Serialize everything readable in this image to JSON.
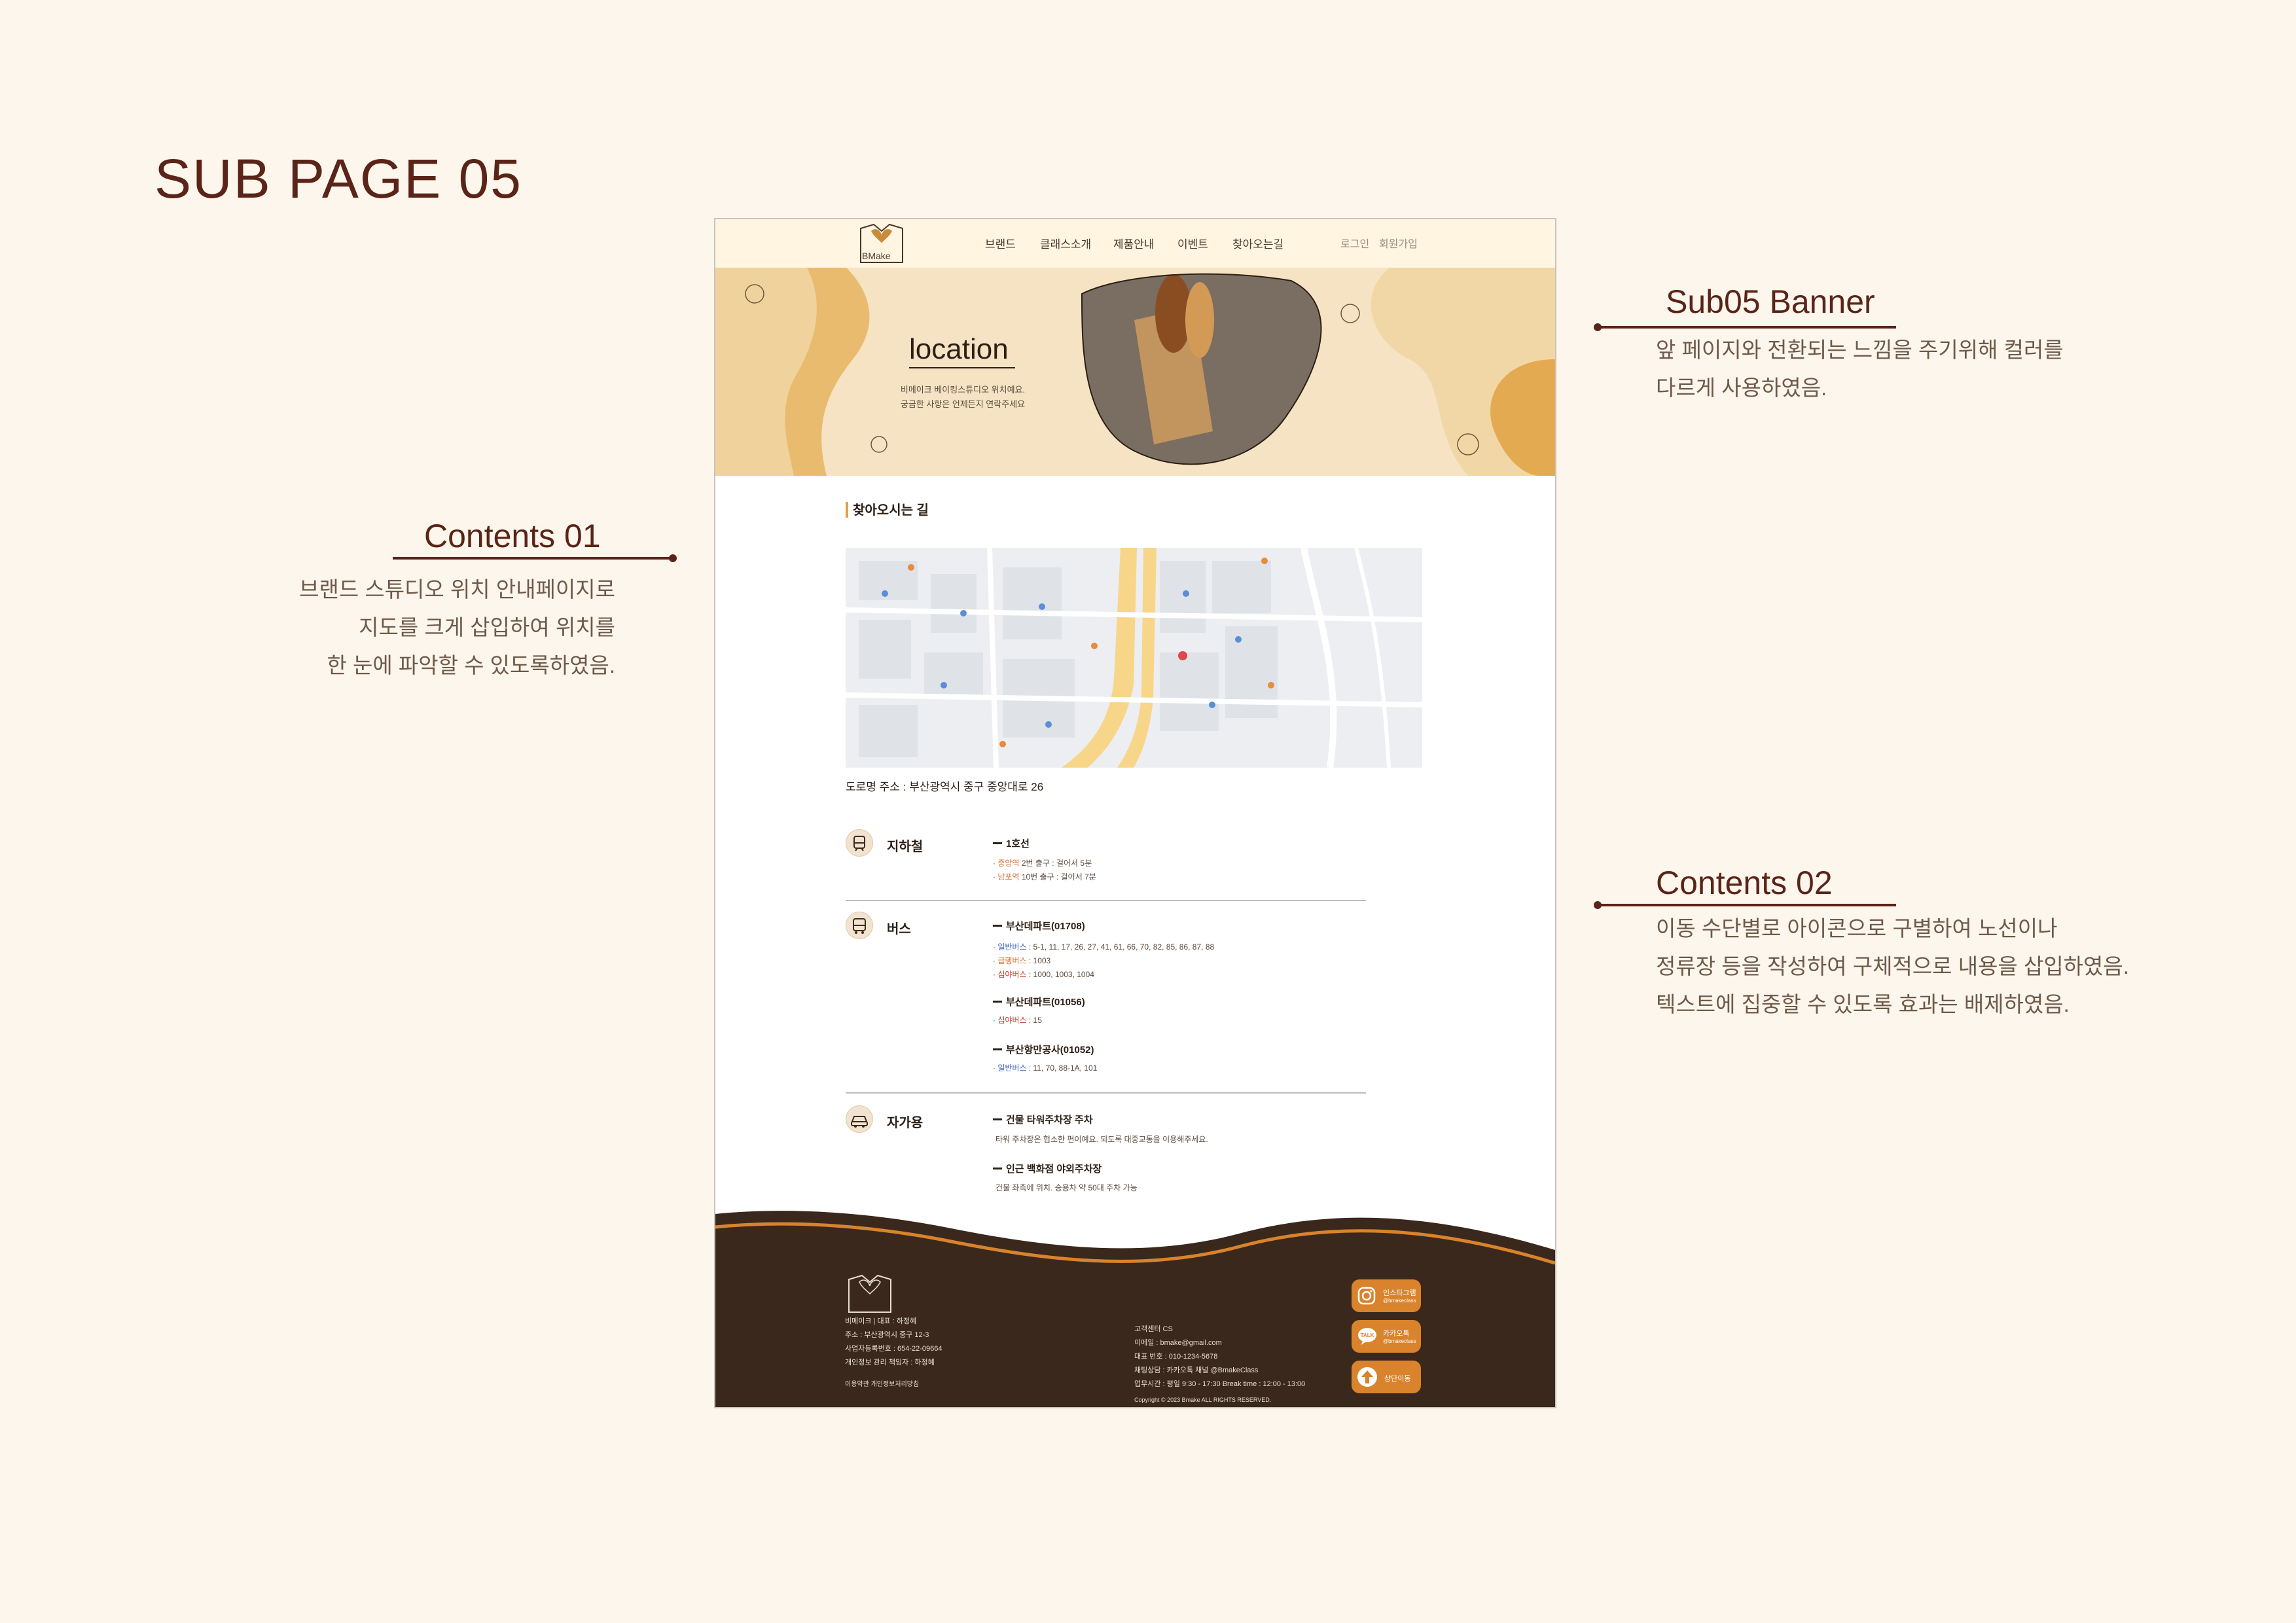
{
  "board": {
    "title": "SUB PAGE 05",
    "banner_note": {
      "title": "Sub05 Banner",
      "lines": [
        "앞 페이지와 전환되는 느낌을 주기위해 컬러를",
        "다르게 사용하였음."
      ]
    },
    "contents01": {
      "title": "Contents 01",
      "lines": [
        "브랜드 스튜디오 위치 안내페이지로",
        "지도를 크게 삽입하여 위치를",
        "한 눈에 파악할 수 있도록하였음."
      ]
    },
    "contents02": {
      "title": "Contents 02",
      "lines": [
        "이동 수단별로 아이콘으로 구별하여 노선이나",
        "정류장 등을 작성하여 구체적으로 내용을 삽입하였음.",
        "텍스트에 집중할 수 있도록 효과는 배제하였음."
      ]
    }
  },
  "site": {
    "logo": "BMake",
    "nav": [
      "브랜드",
      "클래스소개",
      "제품안내",
      "이벤트",
      "찾아오는길"
    ],
    "auth": [
      "로그인",
      "회원가입"
    ],
    "banner": {
      "title": "location",
      "desc": [
        "비메이크 베이킹스튜디오 위치예요.",
        "궁금한 사항은 언제든지 연락주세요"
      ]
    },
    "section_title": "찾아오시는 길",
    "address": "도로명 주소 :  부산광역시 중구 중앙대로 26",
    "transport": {
      "subway": {
        "name": "지하철",
        "lines": [
          {
            "heading": "1호선",
            "stops": [
              [
                "중앙역",
                "2번 출구 : 걸어서 5분"
              ],
              [
                "남포역",
                "10번 출구 : 걸어서 7분"
              ]
            ]
          }
        ]
      },
      "bus": {
        "name": "버스",
        "stops": [
          {
            "heading": "부산데파트(01708)",
            "routes": [
              [
                "일반버스",
                " : 5-1, 11, 17, 26, 27, 41, 61, 66, 70, 82, 85, 86, 87, 88"
              ],
              [
                "급행버스",
                " : 1003"
              ],
              [
                "심야버스",
                " : 1000, 1003, 1004"
              ]
            ]
          },
          {
            "heading": "부산데파트(01056)",
            "routes": [
              [
                "심야버스",
                " : 15"
              ]
            ]
          },
          {
            "heading": "부산항만공사(01052)",
            "routes": [
              [
                "일반버스",
                " : 11, 70, 88-1A, 101"
              ]
            ]
          }
        ]
      },
      "car": {
        "name": "자가용",
        "items": [
          {
            "heading": "건물 타워주차장 주차",
            "desc": "타워 주차장은 협소한 편이예요. 되도록 대중교통을 이용해주세요."
          },
          {
            "heading": "인근 백화점 야외주차장",
            "desc": "건물 좌측에 위치.  승용차 약 50대 주차 가능"
          }
        ]
      }
    },
    "footer": {
      "left": [
        "비메이크  |  대표 : 하정혜",
        "주소 : 부산광역시 중구 12-3",
        "사업자등록번호 : 654-22-09664",
        "개인정보 관리 책임자 : 하정혜"
      ],
      "left_links": "이용약관  개인정보처리방침",
      "right": [
        "고객센터 CS",
        "이메일 : bmake@gmail.com",
        "대표 번호 : 010-1234-5678",
        "채팅상담 : 카카오톡 채널 @BmakeClass",
        "업무시간 : 평일 9:30 - 17:30 Break time : 12:00 - 13:00"
      ],
      "copyright": "Copyright © 2023 Bmake ALL RIGHTS RESERVED.",
      "buttons": [
        {
          "title": "인스타그램",
          "sub": "@bmakeclass"
        },
        {
          "title": "카카오톡",
          "sub": "@bmakeclass"
        },
        {
          "title": "상단이동",
          "sub": ""
        }
      ]
    }
  },
  "colors": {
    "brand": "#5a2418",
    "accent": "#d9832c",
    "banner": "#f5e3c4",
    "footer": "#3a281c",
    "nav_bg": "#fff5e1"
  }
}
